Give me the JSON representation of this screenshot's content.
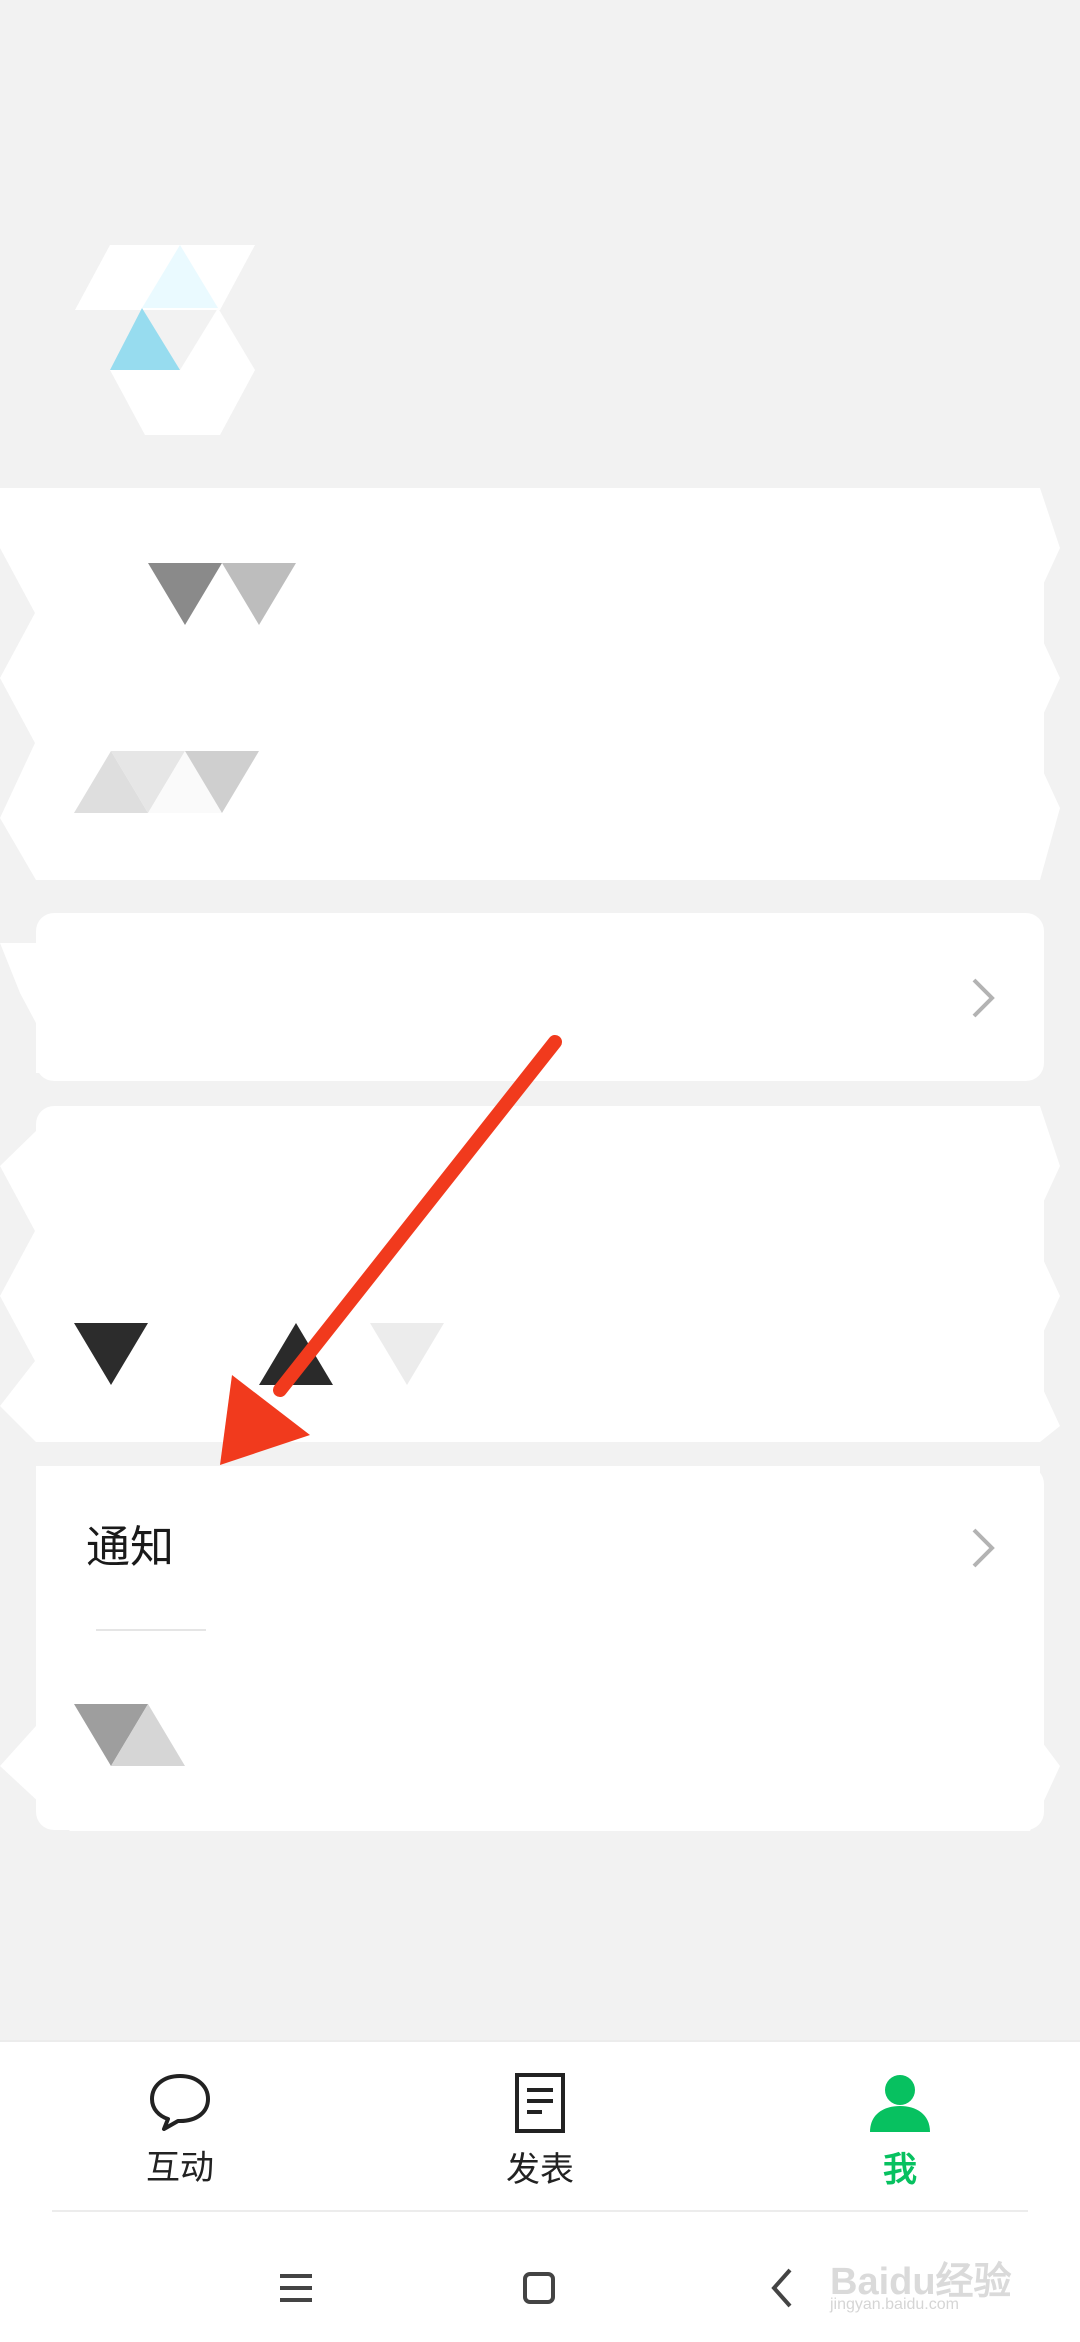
{
  "notification_row": {
    "label": "通知"
  },
  "tabbar": {
    "items": [
      {
        "label": "互动",
        "icon": "chat-bubble-icon",
        "active": false
      },
      {
        "label": "发表",
        "icon": "document-icon",
        "active": false
      },
      {
        "label": "我",
        "icon": "person-icon",
        "active": true
      }
    ],
    "active_color": "#07c160"
  },
  "system_nav": {
    "buttons": [
      "menu-icon",
      "home-square-icon",
      "back-chevron-icon"
    ]
  },
  "annotation": {
    "arrow_color": "#f13a1d"
  },
  "watermark": {
    "text": "Baidu经验",
    "subtext": "jingyan.baidu.com"
  }
}
